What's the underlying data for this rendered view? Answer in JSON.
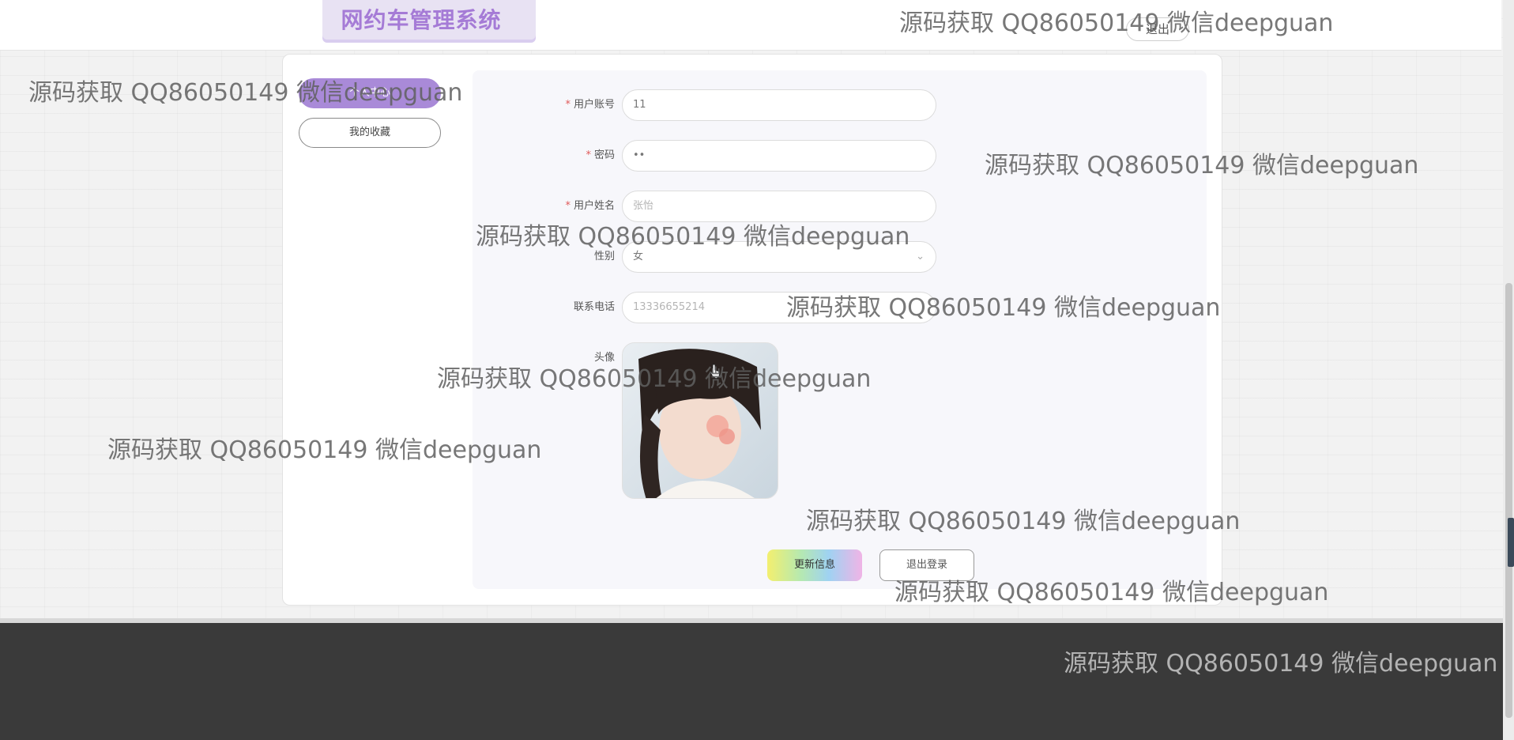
{
  "header": {
    "brand": "网约车管理系统",
    "logout_pill": "退出"
  },
  "sidebar": {
    "items": [
      {
        "label": "个人中心"
      },
      {
        "label": "我的收藏"
      }
    ]
  },
  "form": {
    "account": {
      "label": "用户账号",
      "value": "11",
      "required": true
    },
    "password": {
      "label": "密码",
      "value": "••",
      "required": true
    },
    "name": {
      "label": "用户姓名",
      "placeholder": "张怡",
      "required": true
    },
    "gender": {
      "label": "性别",
      "value": "女"
    },
    "phone": {
      "label": "联系电话",
      "placeholder": "13336655214"
    },
    "avatar": {
      "label": "头像"
    }
  },
  "actions": {
    "update": "更新信息",
    "logout": "退出登录"
  },
  "watermark": {
    "text": "源码获取 QQ86050149 微信deepguan"
  },
  "icons": {
    "chevron": "chevron-down-icon",
    "cursor": "hand-pointer-icon"
  },
  "colors": {
    "brand": "#a57bd6",
    "active_menu": "#a98ad8",
    "required": "#e05a5a",
    "footer": "#3a3a3a"
  }
}
